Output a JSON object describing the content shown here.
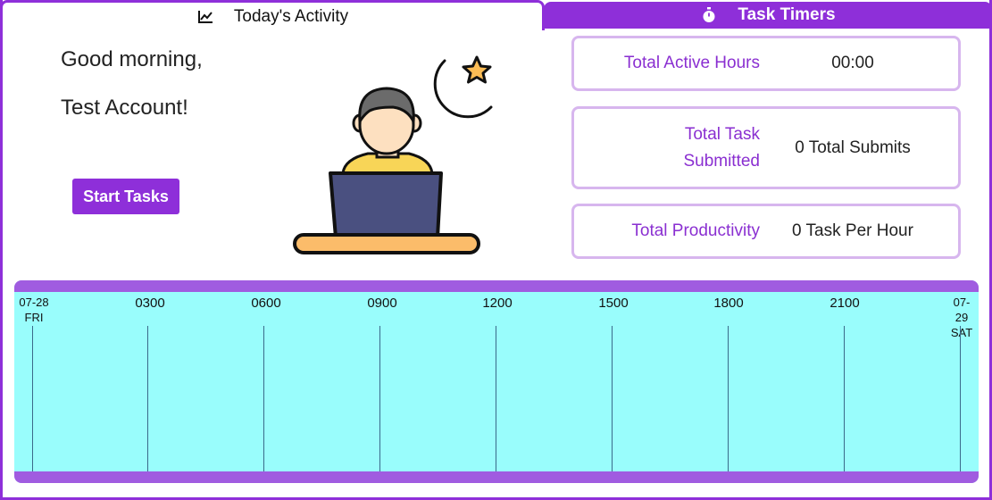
{
  "tabs": {
    "activity_label": "Today's Activity",
    "activity_icon": "line-chart-icon",
    "timers_label": "Task Timers",
    "timers_icon": "stopwatch-icon"
  },
  "greeting": {
    "line1": "Good morning,",
    "line2": "Test Account!"
  },
  "start_button_label": "Start Tasks",
  "stats": [
    {
      "label": "Total Active Hours",
      "value": "00:00"
    },
    {
      "label": "Total Task Submitted",
      "value": "0 Total Submits"
    },
    {
      "label": "Total Productivity",
      "value": "0 Task Per Hour"
    }
  ],
  "timeline": {
    "start": {
      "date": "07-28",
      "day": "FRI"
    },
    "end": {
      "date": "07-29",
      "day": "SAT"
    },
    "hours": [
      "0300",
      "0600",
      "0900",
      "1200",
      "1500",
      "1800",
      "2100"
    ]
  },
  "colors": {
    "accent": "#8e2fd9",
    "stat_label": "#8a2fd1",
    "card_border": "#d7b6ee",
    "timeline_bg": "#99fdfc",
    "timeline_bar": "#a05ce0"
  }
}
